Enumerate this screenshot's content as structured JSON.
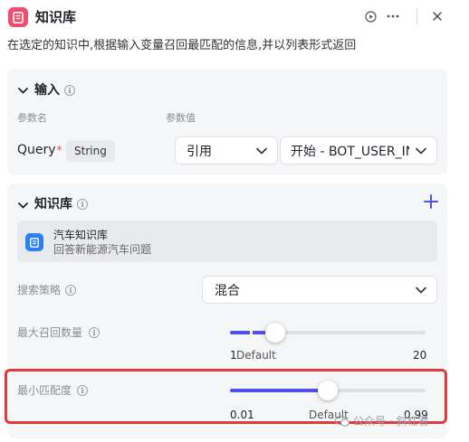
{
  "header": {
    "title": "知识库",
    "description": "在选定的知识中,根据输入变量召回最匹配的信息,并以列表形式返回",
    "icons": [
      "document-icon",
      "play-icon",
      "more-icon",
      "close-icon"
    ]
  },
  "input_section": {
    "title": "输入",
    "col_param_name": "参数名",
    "col_param_value": "参数值",
    "param": {
      "name": "Query",
      "required_mark": "*",
      "type": "String",
      "value_mode": "引用",
      "value_ref": "开始 - BOT_USER_INPUT"
    }
  },
  "knowledge_section": {
    "title": "知识库",
    "item": {
      "name": "汽车知识库",
      "description": "回答新能源汽车问题"
    },
    "search_strategy": {
      "label": "搜索策略",
      "value": "混合"
    },
    "max_recall": {
      "label": "最大召回数量",
      "min_label": "1",
      "default_label": "Default",
      "max_label": "20",
      "value_fraction": 0.23
    },
    "min_match": {
      "label": "最小匹配度",
      "min_label": "0.01",
      "default_label": "Default",
      "max_label": "0.99",
      "value_fraction": 0.5
    }
  },
  "watermark": {
    "text": "公众号 · 斜杠君"
  },
  "colors": {
    "accent": "#4d53e8",
    "header_icon_bg": "#f14c6b",
    "kb_icon_bg": "#2e7ff0",
    "highlight_border": "#e03b3b"
  }
}
